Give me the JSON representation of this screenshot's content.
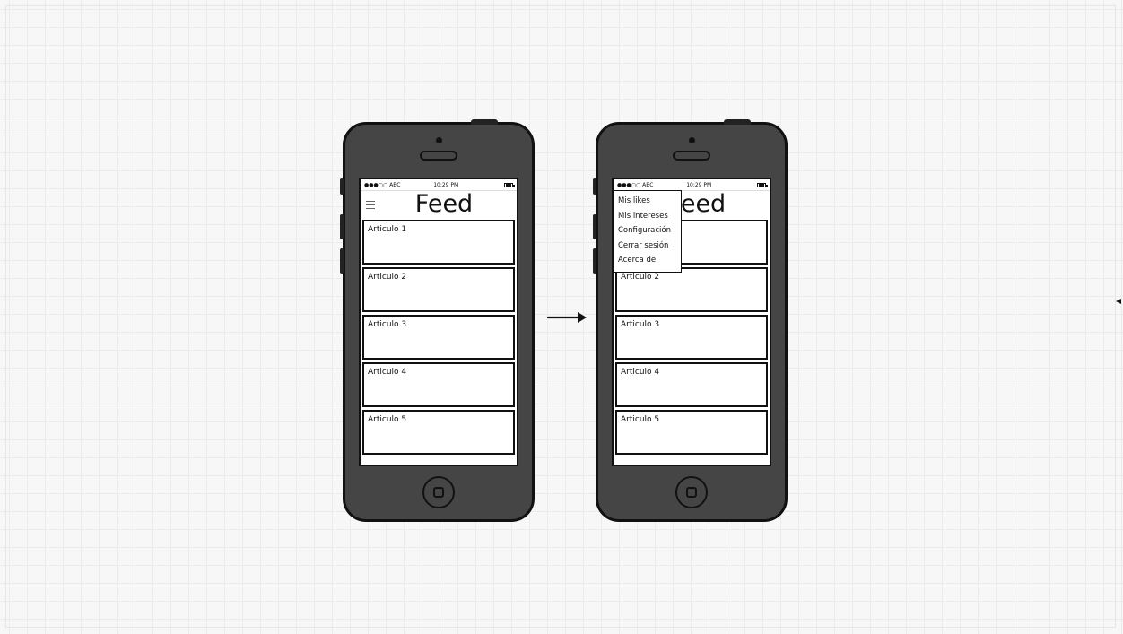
{
  "status_bar": {
    "carrier": "●●●○○ ABC",
    "time": "10:29 PM"
  },
  "feed": {
    "title": "Feed",
    "articles": [
      "Articulo 1",
      "Articulo 2",
      "Articulo 3",
      "Articulo 4",
      "Articulo 5"
    ]
  },
  "menu": {
    "items": [
      "Mis likes",
      "Mis intereses",
      "Configuración",
      "Cerrar sesión",
      "Acerca de"
    ]
  }
}
